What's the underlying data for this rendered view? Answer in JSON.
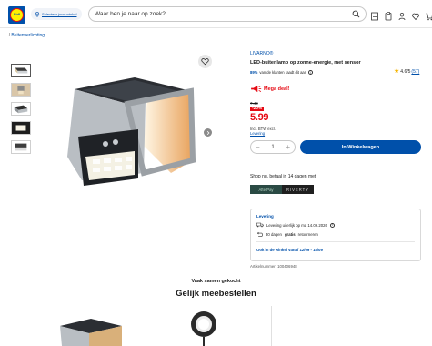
{
  "header": {
    "logo_text": "Lidl",
    "store_link": "Selecteer jouw winkel",
    "search_placeholder": "Waar ben je naar op zoek?",
    "icons": [
      "catalog-icon",
      "list-icon",
      "account-icon",
      "favorites-icon",
      "cart-icon"
    ]
  },
  "breadcrumb": {
    "ellipsis": "...",
    "separator": "/",
    "current": "Buitenverlichting"
  },
  "gallery": {
    "thumbnail_count": 5,
    "active_index": 0
  },
  "product": {
    "brand": "LIVARNO®",
    "title": "LED-buitenlamp op zonne-energie, met sensor",
    "recommend_percent": "89%",
    "recommend_text": "van de klanten raadt dit aan",
    "rating": "4.6/5",
    "review_count": "(57)",
    "deal_label": "Mega deal!",
    "old_price": "7.49",
    "discount": "-20%",
    "price": "5.99",
    "vat_line1": "Incl. BTW excl.",
    "vat_line2": "Levering",
    "quantity": "1",
    "cart_button": "In Winkelwagen",
    "article_label": "Artikelnummer:",
    "article_number": "100406948"
  },
  "payment": {
    "label": "Shop nu, betaal in 14 dagen met",
    "logo_a": "AfterPay",
    "logo_b": "RIVERTY"
  },
  "delivery": {
    "title": "Levering",
    "line1": "Levering uiterlijk op ma 14.09.2026",
    "line2_prefix": "30 dagen",
    "line2_bold": "gratis",
    "line2_suffix": "retourneren",
    "instore": "Ook in de winkel vanaf 12/09 - 18/09"
  },
  "recommendations": {
    "kicker": "Vaak samen gekocht",
    "heading": "Gelijk meebestellen"
  },
  "colors": {
    "brand_blue": "#0050aa",
    "deal_red": "#e60a14",
    "star_yellow": "#f5b400"
  }
}
